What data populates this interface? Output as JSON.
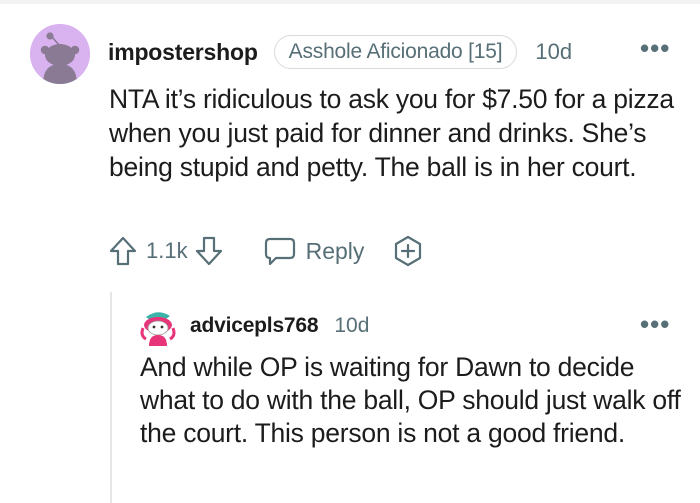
{
  "comment": {
    "username": "impostershop",
    "flair": "Asshole Aficionado [15]",
    "time": "10d",
    "more": "•••",
    "body": "NTA it’s ridiculous to ask you for $7.50 for a pizza when you just paid for dinner and drinks. She’s being stupid and petty. The ball is in her court.",
    "score": "1.1k",
    "reply_label": "Reply",
    "icons": {
      "upvote": "upvote-arrow-icon",
      "downvote": "downvote-arrow-icon",
      "reply": "speech-bubble-icon",
      "award": "award-plus-icon"
    }
  },
  "reply": {
    "username": "advicepls768",
    "time": "10d",
    "more": "•••",
    "body": "And while OP is waiting for Dawn to decide what to do with the ball, OP should just walk off the court. This person is not a good friend."
  },
  "colors": {
    "text": "#1c1c1c",
    "meta": "#576f76",
    "avatar_bg": "#d9b3f0",
    "flair_border": "#d8dadd",
    "thread_line": "#e5e5e5"
  }
}
